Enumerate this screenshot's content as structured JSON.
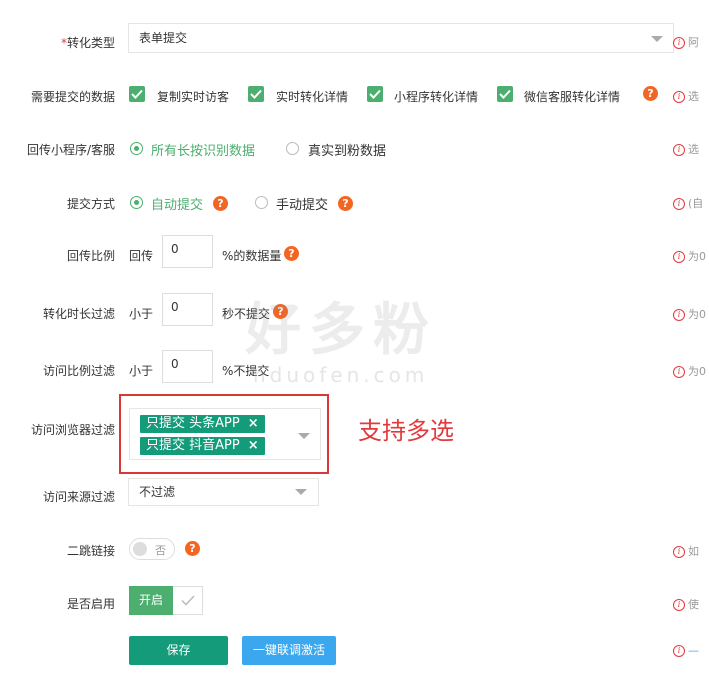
{
  "rows": {
    "conversion_type": {
      "required_mark": "*",
      "label": "转化类型",
      "value": "表单提交",
      "hint": "阿"
    },
    "data_to_submit": {
      "label": "需要提交的数据",
      "options": [
        {
          "label": "复制实时访客",
          "checked": true
        },
        {
          "label": "实时转化详情",
          "checked": true
        },
        {
          "label": "小程序转化详情",
          "checked": true
        },
        {
          "label": "微信客服转化详情",
          "checked": true
        }
      ],
      "hint": "选"
    },
    "callback_mini": {
      "label": "回传小程序/客服",
      "options": [
        {
          "label": "所有长按识别数据",
          "selected": true
        },
        {
          "label": "真实到粉数据",
          "selected": false
        }
      ],
      "hint": "选"
    },
    "submit_method": {
      "label": "提交方式",
      "options": [
        {
          "label": "自动提交",
          "selected": true
        },
        {
          "label": "手动提交",
          "selected": false
        }
      ],
      "hint": "(自"
    },
    "callback_ratio": {
      "label": "回传比例",
      "prefix": "回传",
      "value": "0",
      "suffix": "%的数据量",
      "hint": "为0"
    },
    "duration_filter": {
      "label": "转化时长过滤",
      "prefix": "小于",
      "value": "0",
      "suffix": "秒不提交",
      "hint": "为0"
    },
    "visit_ratio_filter": {
      "label": "访问比例过滤",
      "prefix": "小于",
      "value": "0",
      "suffix": "%不提交",
      "hint": "为0"
    },
    "browser_filter": {
      "label": "访问浏览器过滤",
      "tags": [
        "只提交 头条APP",
        "只提交 抖音APP"
      ],
      "remove_symbol": "×",
      "annotation": "支持多选"
    },
    "source_filter": {
      "label": "访问来源过滤",
      "value": "不过滤"
    },
    "second_jump": {
      "label": "二跳链接",
      "toggle_text": "否",
      "hint": "如"
    },
    "enabled": {
      "label": "是否启用",
      "on_text": "开启",
      "hint": "使"
    }
  },
  "help_symbol": "?",
  "info_symbol": "i",
  "actions": {
    "save": "保存",
    "activate": "一键联调激活",
    "hint": "—"
  },
  "watermark": {
    "line1": "好多粉",
    "line2": "hduofen.com"
  },
  "colors": {
    "primary_green": "#139b7a",
    "check_green": "#4cae6f",
    "blue": "#3aa7ef",
    "help_orange": "#f26522",
    "annotation_red": "#e4393c"
  }
}
